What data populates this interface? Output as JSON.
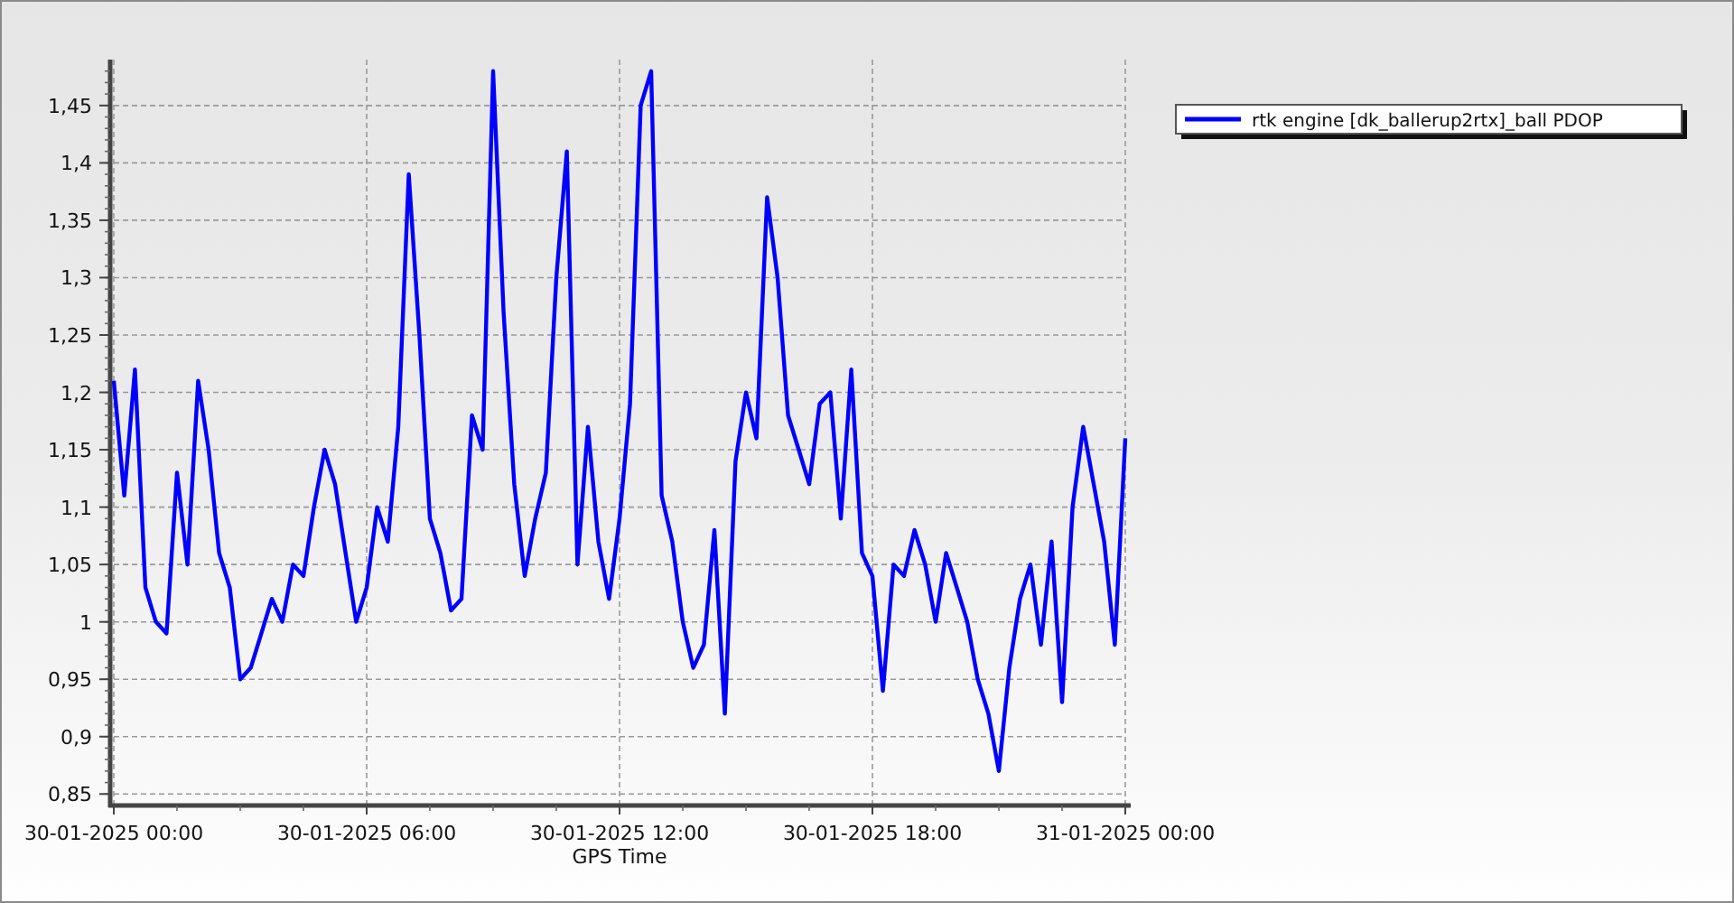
{
  "chart_data": {
    "type": "line",
    "grid": true,
    "xlabel": "GPS Time",
    "ylim": [
      0.84,
      1.49
    ],
    "yticks": [
      {
        "value": 0.85,
        "label": "0,85"
      },
      {
        "value": 0.9,
        "label": "0,9"
      },
      {
        "value": 0.95,
        "label": "0,95"
      },
      {
        "value": 1,
        "label": "1"
      },
      {
        "value": 1.05,
        "label": "1,05"
      },
      {
        "value": 1.1,
        "label": "1,1"
      },
      {
        "value": 1.15,
        "label": "1,15"
      },
      {
        "value": 1.2,
        "label": "1,2"
      },
      {
        "value": 1.25,
        "label": "1,25"
      },
      {
        "value": 1.3,
        "label": "1,3"
      },
      {
        "value": 1.35,
        "label": "1,35"
      },
      {
        "value": 1.4,
        "label": "1,4"
      },
      {
        "value": 1.45,
        "label": "1,45"
      }
    ],
    "categories": [
      "30-01-2025 00:00",
      null,
      null,
      null,
      null,
      null,
      null,
      null,
      null,
      null,
      null,
      null,
      null,
      null,
      null,
      null,
      null,
      null,
      null,
      null,
      null,
      null,
      null,
      null,
      "30-01-2025 06:00",
      null,
      null,
      null,
      null,
      null,
      null,
      null,
      null,
      null,
      null,
      null,
      null,
      null,
      null,
      null,
      null,
      null,
      null,
      null,
      null,
      null,
      null,
      null,
      "30-01-2025 12:00",
      null,
      null,
      null,
      null,
      null,
      null,
      null,
      null,
      null,
      null,
      null,
      null,
      null,
      null,
      null,
      null,
      null,
      null,
      null,
      null,
      null,
      null,
      null,
      "30-01-2025 18:00",
      null,
      null,
      null,
      null,
      null,
      null,
      null,
      null,
      null,
      null,
      null,
      null,
      null,
      null,
      null,
      null,
      null,
      null,
      null,
      null,
      null,
      null,
      null,
      "31-01-2025 00:00"
    ],
    "series": [
      {
        "name": "rtk engine [dk_ballerup2rtx]_ball PDOP",
        "color": "#0000ff",
        "values": [
          1.21,
          1.11,
          1.22,
          1.03,
          1.0,
          0.99,
          1.13,
          1.05,
          1.21,
          1.15,
          1.06,
          1.03,
          0.95,
          0.96,
          0.99,
          1.02,
          1.0,
          1.05,
          1.04,
          1.1,
          1.15,
          1.12,
          1.06,
          1.0,
          1.03,
          1.1,
          1.07,
          1.17,
          1.39,
          1.25,
          1.09,
          1.06,
          1.01,
          1.02,
          1.18,
          1.15,
          1.48,
          1.27,
          1.12,
          1.04,
          1.09,
          1.13,
          1.3,
          1.41,
          1.05,
          1.17,
          1.07,
          1.02,
          1.09,
          1.19,
          1.45,
          1.48,
          1.11,
          1.07,
          1.0,
          0.96,
          0.98,
          1.08,
          0.92,
          1.14,
          1.2,
          1.16,
          1.37,
          1.3,
          1.18,
          1.15,
          1.12,
          1.19,
          1.2,
          1.09,
          1.22,
          1.06,
          1.04,
          0.94,
          1.05,
          1.04,
          1.08,
          1.05,
          1.0,
          1.06,
          1.03,
          1.0,
          0.95,
          0.92,
          0.87,
          0.96,
          1.02,
          1.05,
          0.98,
          1.07,
          0.93,
          1.1,
          1.17,
          1.12,
          1.07,
          0.98,
          1.16
        ]
      }
    ]
  }
}
